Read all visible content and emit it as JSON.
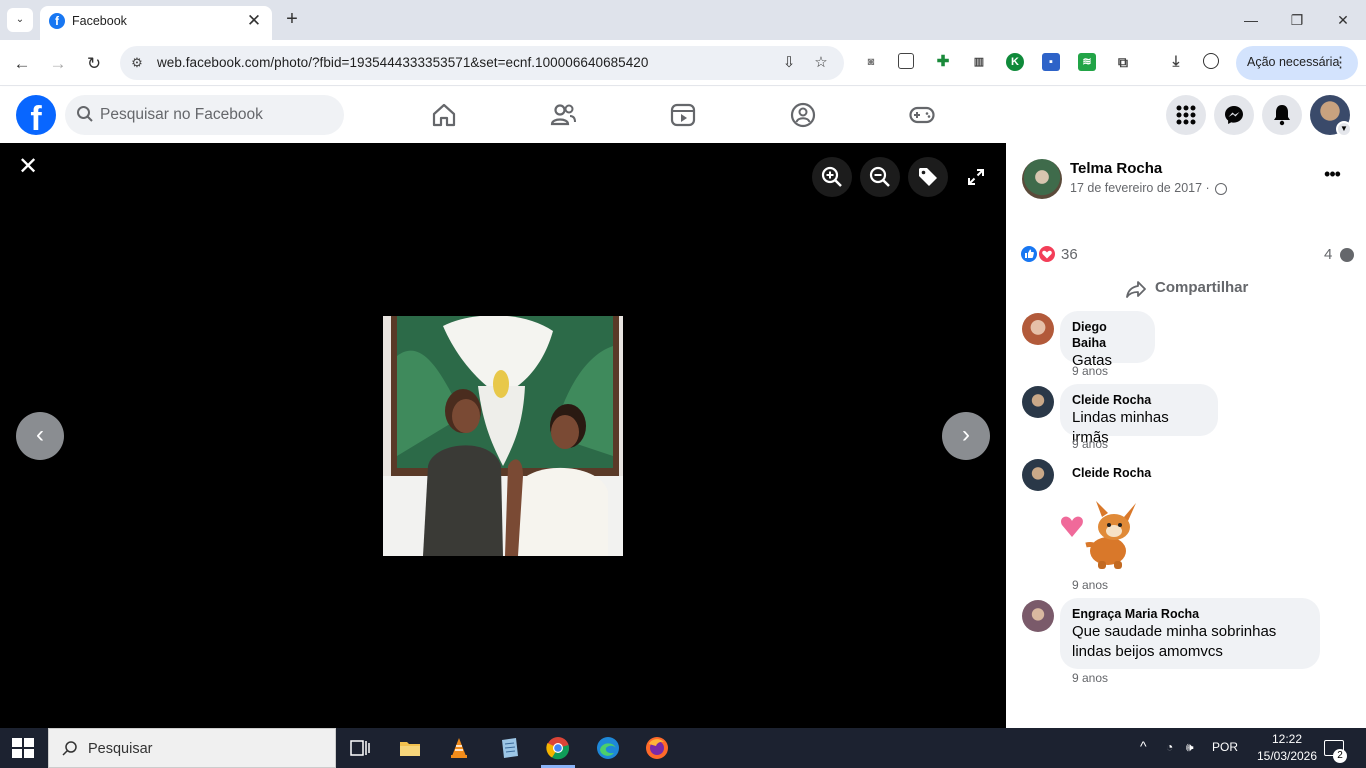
{
  "browser": {
    "tab_title": "Facebook",
    "tab_favicon": "f",
    "tab_close": "✕",
    "new_tab": "+",
    "url": "web.facebook.com/photo/?fbid=1935444333353571&set=ecnf.100006640685420",
    "action_button": "Ação necessária",
    "action_menu": "⋮",
    "window_controls": [
      "minimize-icon",
      "restore-icon",
      "close-icon"
    ],
    "extensions": [
      "camera-icon",
      "copy-icon",
      "plus-extension-icon",
      "bank-icon",
      "k-extension-icon",
      "save-disk-icon",
      "green-extension-icon",
      "puzzle-icon"
    ]
  },
  "facebook": {
    "logo": "f",
    "search_placeholder": "Pesquisar no Facebook",
    "nav": [
      "home-icon",
      "friends-icon",
      "video-icon",
      "groups-icon",
      "gaming-icon"
    ],
    "right_icons": [
      "menu-grid-icon",
      "messenger-icon",
      "bell-icon"
    ]
  },
  "viewer": {
    "close": "✕",
    "prev": "‹",
    "next": "›"
  },
  "post": {
    "author": "Telma Rocha",
    "date": "17 de fevereiro de 2017 ·",
    "more": "•••",
    "reactions_count": "36",
    "comments_count": "4",
    "share_label": "Compartilhar"
  },
  "comments": [
    {
      "name": "Diego Baiha",
      "text": "Gatas",
      "time": "9 anos"
    },
    {
      "name": "Cleide Rocha",
      "text": "Lindas minhas irmãs",
      "time": "9 anos"
    },
    {
      "name": "Cleide Rocha",
      "text": "",
      "time": "9 anos",
      "sticker": "dog-heart-sticker"
    },
    {
      "name": "Engraça Maria Rocha",
      "text_line1": "Que saudade minha sobrinhas",
      "text_line2": "lindas beijos amomvcs",
      "time": "9 anos"
    }
  ],
  "taskbar": {
    "search_placeholder": "Pesquisar",
    "language": "POR",
    "time": "12:22",
    "date": "15/03/2026",
    "notifications": "2",
    "apps": [
      "task-view-icon",
      "file-explorer-icon",
      "vlc-icon",
      "notepad-icon",
      "chrome-icon",
      "edge-icon",
      "firefox-icon"
    ]
  },
  "colors": {
    "fb_blue": "#0866ff",
    "like_blue": "#1877f2",
    "love_red": "#f33e58",
    "chrome_tabstrip": "#dfe3eb",
    "action_chip": "#d3e3fd"
  }
}
